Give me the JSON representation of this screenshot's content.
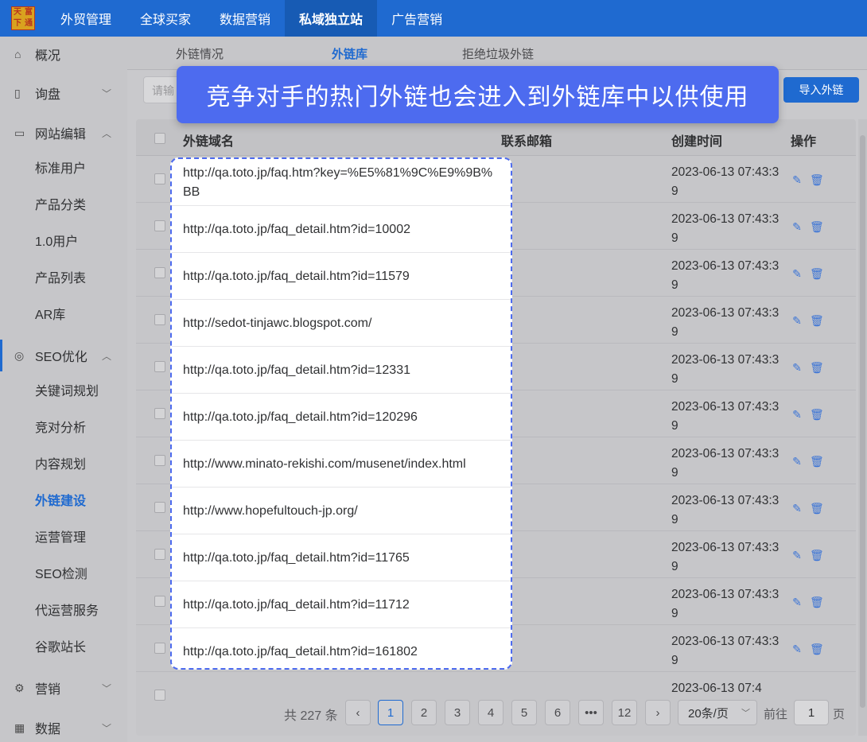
{
  "topbar": {
    "logo_chars": [
      "天",
      "富",
      "下",
      "通"
    ],
    "nav": [
      "外贸管理",
      "全球买家",
      "数据营销",
      "私域独立站",
      "广告营销"
    ],
    "active_index": 3
  },
  "sidebar": {
    "groups": [
      {
        "label": "概况",
        "icon": "home-icon"
      },
      {
        "label": "询盘",
        "icon": "clipboard-icon",
        "chevron": "down"
      },
      {
        "label": "网站编辑",
        "icon": "monitor-icon",
        "chevron": "up"
      },
      {
        "label": "SEO优化",
        "icon": "seo-icon",
        "chevron": "up"
      },
      {
        "label": "营销",
        "icon": "gear-icon",
        "chevron": "down"
      },
      {
        "label": "数据",
        "icon": "chart-icon",
        "chevron": "down"
      }
    ],
    "website_sub": [
      "标准用户",
      "产品分类",
      "1.0用户",
      "产品列表",
      "AR库"
    ],
    "seo_sub": [
      "关键词规划",
      "竞对分析",
      "内容规划",
      "外链建设",
      "运营管理",
      "SEO检测",
      "代运营服务",
      "谷歌站长"
    ],
    "current_sub": "外链建设"
  },
  "tabs": [
    "外链情况",
    "外链库",
    "拒绝垃圾外链"
  ],
  "active_tab": "外链库",
  "filter": {
    "placeholder": "请输"
  },
  "import_label": "导入外链",
  "banner_text": "竞争对手的热门外链也会进入到外链库中以供使用",
  "table": {
    "headers": {
      "domain": "外链域名",
      "email": "联系邮箱",
      "created": "创建时间",
      "ops": "操作"
    },
    "rows": [
      {
        "url": "http://qa.toto.jp/faq.htm?key=%E5%81%9C%E9%9B%BB",
        "created": "2023-06-13 07:43:39"
      },
      {
        "url": "http://qa.toto.jp/faq_detail.htm?id=10002",
        "created": "2023-06-13 07:43:39"
      },
      {
        "url": "http://qa.toto.jp/faq_detail.htm?id=11579",
        "created": "2023-06-13 07:43:39"
      },
      {
        "url": "http://sedot-tinjawc.blogspot.com/",
        "created": "2023-06-13 07:43:39"
      },
      {
        "url": "http://qa.toto.jp/faq_detail.htm?id=12331",
        "created": "2023-06-13 07:43:39"
      },
      {
        "url": "http://qa.toto.jp/faq_detail.htm?id=120296",
        "created": "2023-06-13 07:43:39"
      },
      {
        "url": "http://www.minato-rekishi.com/musenet/index.html",
        "created": "2023-06-13 07:43:39"
      },
      {
        "url": "http://www.hopefultouch-jp.org/",
        "created": "2023-06-13 07:43:39"
      },
      {
        "url": "http://qa.toto.jp/faq_detail.htm?id=11765",
        "created": "2023-06-13 07:43:39"
      },
      {
        "url": "http://qa.toto.jp/faq_detail.htm?id=11712",
        "created": "2023-06-13 07:43:39"
      },
      {
        "url": "http://qa.toto.jp/faq_detail.htm?id=161802",
        "created": "2023-06-13 07:43:39"
      }
    ],
    "partial_row_created": "2023-06-13 07:4"
  },
  "pagination": {
    "total": "共 227 条",
    "pages": [
      "1",
      "2",
      "3",
      "4",
      "5",
      "6",
      "•••",
      "12"
    ],
    "current": "1",
    "page_size": "20条/页",
    "goto_label": "前往",
    "goto_value": "1",
    "page_suffix": "页"
  }
}
